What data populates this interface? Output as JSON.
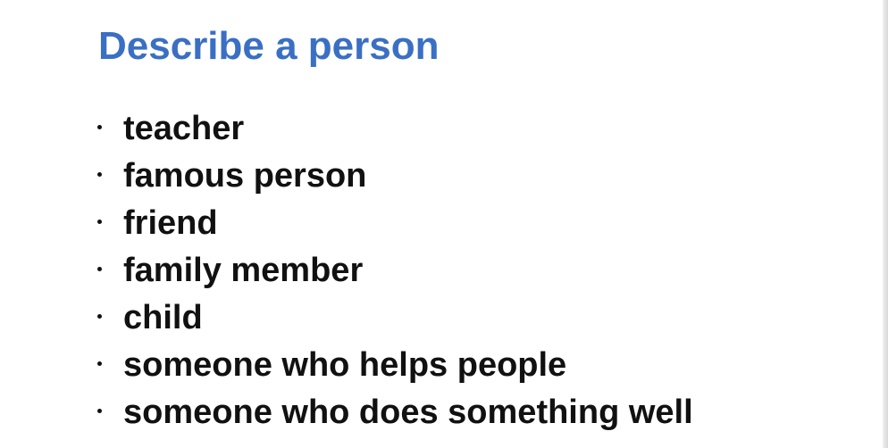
{
  "slide": {
    "title": "Describe a person",
    "title_color": "#3a6fc4",
    "text_color": "#111111",
    "bullets": [
      "teacher",
      "famous person",
      "friend",
      "family member",
      "child",
      "someone who helps people",
      "someone who does something well"
    ]
  }
}
